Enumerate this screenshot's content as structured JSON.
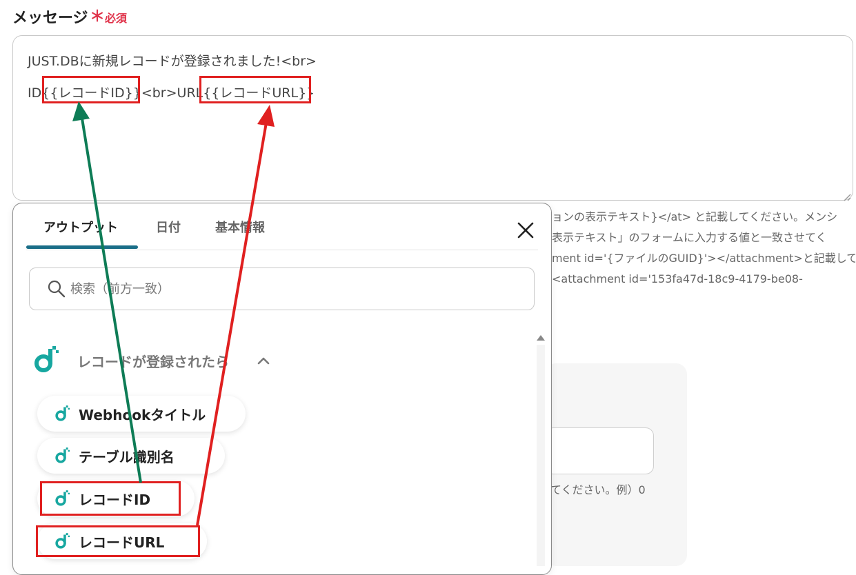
{
  "field": {
    "label": "メッセージ",
    "required_mark": "＊",
    "required_text": "必須"
  },
  "message": {
    "line1": "JUST.DBに新規レコードが登録されました!<br>",
    "line2": "ID{{レコードID}}<br>URL{{レコードURL}}"
  },
  "helptext": [
    "ョンの表示テキスト}</at> と記載してください。メンシ",
    "表示テキスト」のフォームに入力する値と一致させてく",
    "ment id='{ファイルのGUID}'></attachment>と記載して",
    " <attachment id='153fa47d-18c9-4179-be08-"
  ],
  "bg_hint": "てください。例）0",
  "popup": {
    "tabs": [
      "アウトプット",
      "日付",
      "基本情報"
    ],
    "active_tab": 0,
    "search_placeholder": "検索（前方一致）",
    "group_title": "レコードが登録されたら",
    "items": [
      "Webhookタイトル",
      "テーブル識別名",
      "レコードID",
      "レコードURL"
    ]
  },
  "icons": {
    "close": "close-icon",
    "search": "search-icon",
    "brand": "justdb-logo-icon",
    "chevron": "chevron-up-icon"
  },
  "colors": {
    "brand_teal": "#17a7a0",
    "required_red": "#e0334a",
    "highlight_red": "#e02020",
    "arrow_green": "#0e7c56",
    "tab_underline": "#1a6e88"
  }
}
